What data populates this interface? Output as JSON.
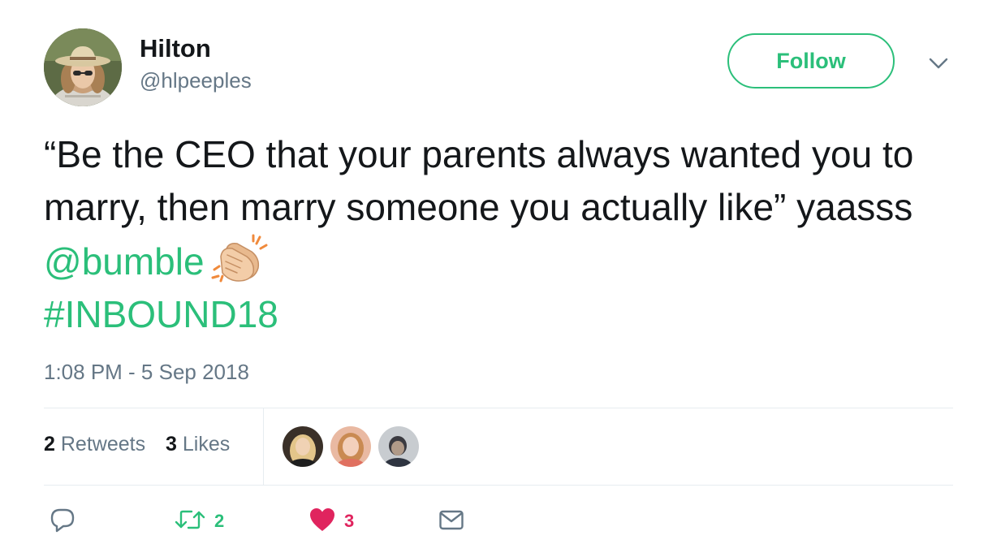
{
  "author": {
    "name": "Hilton",
    "handle": "@hlpeeples"
  },
  "follow_label": "Follow",
  "tweet": {
    "text_part1": "“Be the CEO that your parents always wanted you to marry, then marry someone you actually like” yaasss ",
    "mention": "@bumble",
    "emoji_icon": "clapping-hands-icon",
    "hashtag": "#INBOUND18",
    "timestamp": "1:08 PM - 5 Sep 2018"
  },
  "stats": {
    "retweets_count": "2",
    "retweets_label": "Retweets",
    "likes_count": "3",
    "likes_label": "Likes"
  },
  "actions": {
    "reply_icon": "reply-icon",
    "retweet_icon": "retweet-icon",
    "retweet_count": "2",
    "like_icon": "heart-icon",
    "like_count": "3",
    "dm_icon": "envelope-icon"
  },
  "colors": {
    "accent": "#2bbf7a",
    "like": "#e0245e",
    "muted": "#657786",
    "text": "#14171a",
    "divider": "#e6ecf0"
  }
}
